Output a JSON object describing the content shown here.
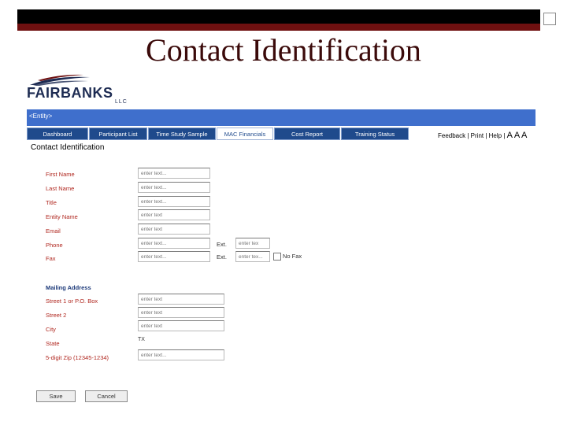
{
  "slide": {
    "title": "Contact Identification"
  },
  "logo": {
    "name": "FAIRBANKS",
    "suffix": "LLC"
  },
  "header": {
    "entity_label": "<Entity>"
  },
  "tabs": [
    {
      "label": "Dashboard"
    },
    {
      "label": "Participant List"
    },
    {
      "label": "Time Study Sample"
    },
    {
      "label": "MAC Financials"
    },
    {
      "label": "Cost Report"
    },
    {
      "label": "Training Status"
    }
  ],
  "toplinks": {
    "feedback": "Feedback",
    "print": "Print",
    "help": "Help",
    "sizes": "A A A"
  },
  "form": {
    "title": "Contact Identification",
    "fields": {
      "first_name": {
        "label": "First Name",
        "placeholder": "enter text..."
      },
      "last_name": {
        "label": "Last Name",
        "placeholder": "enter text..."
      },
      "title": {
        "label": "Title",
        "placeholder": "enter text..."
      },
      "entity_name": {
        "label": "Entity Name",
        "placeholder": "enter text"
      },
      "email": {
        "label": "Email",
        "placeholder": "enter text"
      },
      "phone": {
        "label": "Phone",
        "placeholder": "enter text..."
      },
      "fax": {
        "label": "Fax",
        "placeholder": "enter text..."
      }
    },
    "phone_ext": {
      "label": "Ext.",
      "placeholder": "enter tex"
    },
    "fax_ext": {
      "label": "Ext.",
      "placeholder": "enter tex..."
    },
    "no_fax": {
      "label": "No Fax"
    },
    "mailing": {
      "heading": "Mailing Address",
      "street1": {
        "label": "Street 1 or P.O. Box",
        "placeholder": "enter text"
      },
      "street2": {
        "label": "Street 2",
        "placeholder": "enter text"
      },
      "city": {
        "label": "City",
        "placeholder": "enter text"
      },
      "state": {
        "label": "State",
        "value": "TX"
      },
      "zip": {
        "label": "5-digit Zip (12345-1234)",
        "placeholder": "enter text..."
      }
    },
    "buttons": {
      "save": "Save",
      "cancel": "Cancel"
    }
  }
}
